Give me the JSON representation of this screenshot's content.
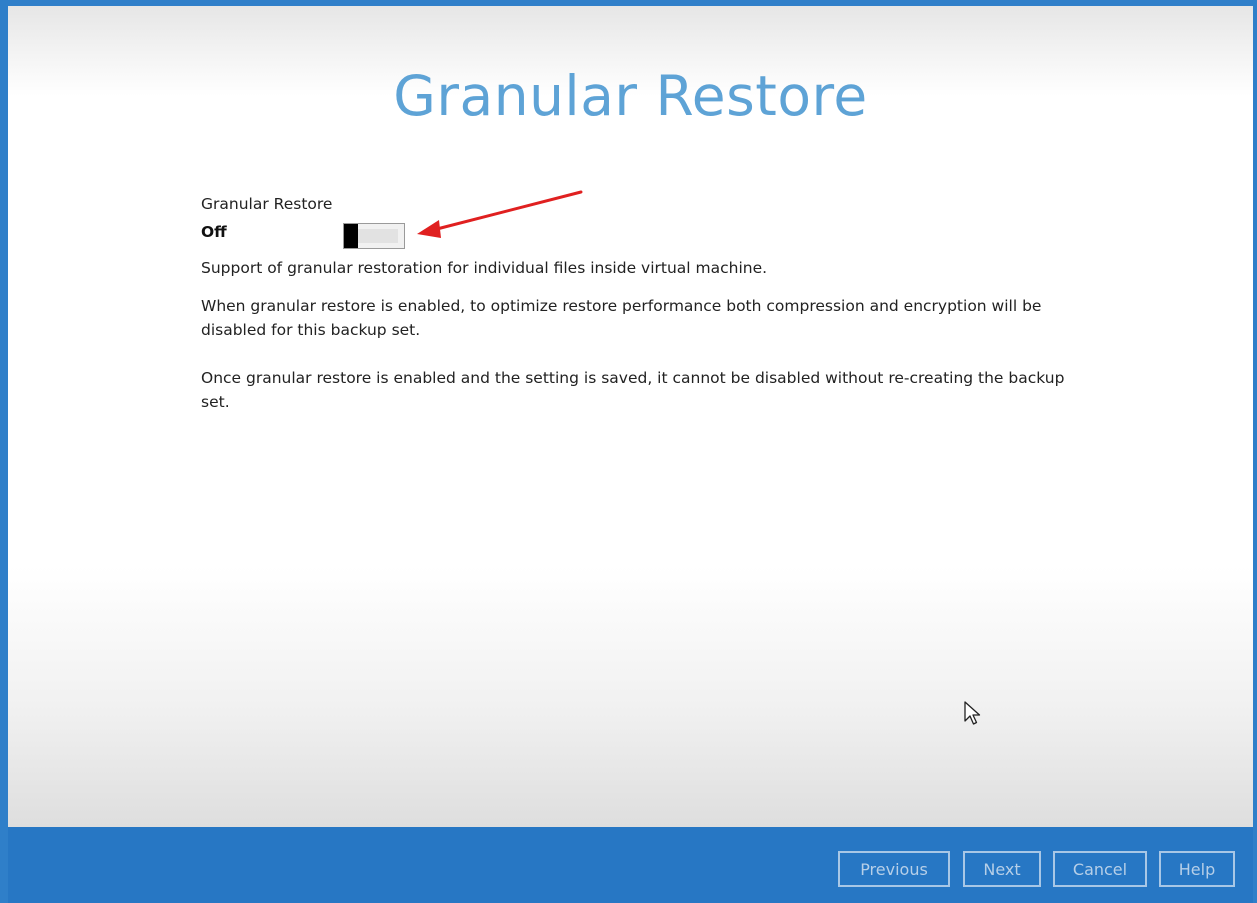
{
  "page": {
    "title": "Granular Restore"
  },
  "granular_restore": {
    "label": "Granular Restore",
    "state": "Off",
    "enabled": false
  },
  "descriptions": {
    "support": "Support of granular restoration for individual files inside virtual machine.",
    "compression_note": "When granular restore is enabled, to optimize restore performance both compression and encryption will be disabled for this backup set.",
    "irreversible_note": "Once granular restore is enabled and the setting is saved, it cannot be disabled without re-creating the backup set."
  },
  "footer": {
    "previous_label": "Previous",
    "next_label": "Next",
    "cancel_label": "Cancel",
    "help_label": "Help"
  },
  "colors": {
    "accent": "#2777c4",
    "title": "#5ea3d6",
    "annotation_arrow": "#e02020"
  },
  "icons": {
    "pointer": "mouse-cursor-icon",
    "annotation": "red-arrow-annotation"
  }
}
